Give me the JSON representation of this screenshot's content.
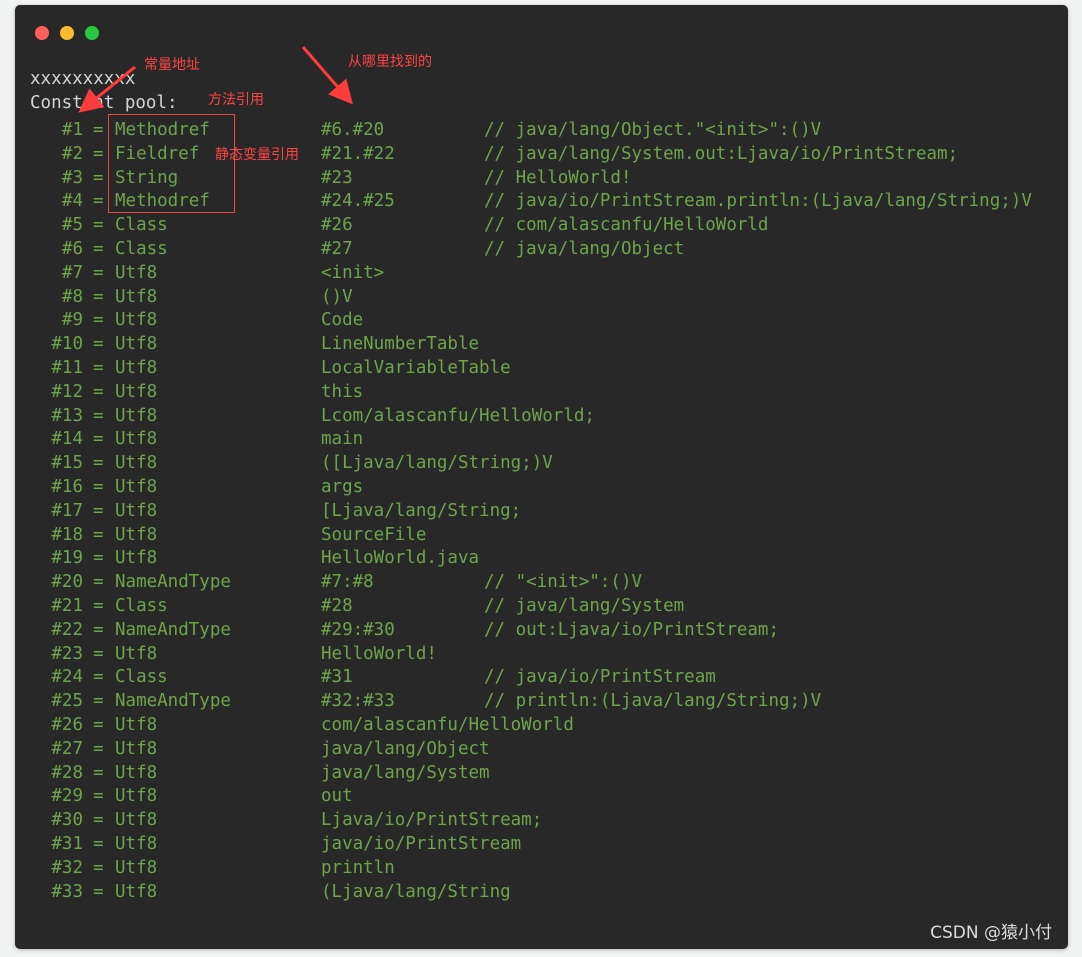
{
  "window": {
    "traffic_lights": {
      "close": "#fe5f57",
      "minimize": "#febc2e",
      "maximize": "#28c840"
    }
  },
  "terminal": {
    "line1": "xxxxxxxxxx",
    "line2": "Constant pool:",
    "rows": [
      {
        "idx": "#1",
        "eq": "=",
        "tag": "Methodref",
        "val": "#6.#20",
        "cmt": "// java/lang/Object.\"<init>\":()V"
      },
      {
        "idx": "#2",
        "eq": "=",
        "tag": "Fieldref",
        "val": "#21.#22",
        "cmt": "// java/lang/System.out:Ljava/io/PrintStream;"
      },
      {
        "idx": "#3",
        "eq": "=",
        "tag": "String",
        "val": "#23",
        "cmt": "// HelloWorld!"
      },
      {
        "idx": "#4",
        "eq": "=",
        "tag": "Methodref",
        "val": "#24.#25",
        "cmt": "// java/io/PrintStream.println:(Ljava/lang/String;)V"
      },
      {
        "idx": "#5",
        "eq": "=",
        "tag": "Class",
        "val": "#26",
        "cmt": "// com/alascanfu/HelloWorld"
      },
      {
        "idx": "#6",
        "eq": "=",
        "tag": "Class",
        "val": "#27",
        "cmt": "// java/lang/Object"
      },
      {
        "idx": "#7",
        "eq": "=",
        "tag": "Utf8",
        "val": "<init>",
        "cmt": ""
      },
      {
        "idx": "#8",
        "eq": "=",
        "tag": "Utf8",
        "val": "()V",
        "cmt": ""
      },
      {
        "idx": "#9",
        "eq": "=",
        "tag": "Utf8",
        "val": "Code",
        "cmt": ""
      },
      {
        "idx": "#10",
        "eq": "=",
        "tag": "Utf8",
        "val": "LineNumberTable",
        "cmt": ""
      },
      {
        "idx": "#11",
        "eq": "=",
        "tag": "Utf8",
        "val": "LocalVariableTable",
        "cmt": ""
      },
      {
        "idx": "#12",
        "eq": "=",
        "tag": "Utf8",
        "val": "this",
        "cmt": ""
      },
      {
        "idx": "#13",
        "eq": "=",
        "tag": "Utf8",
        "val": "Lcom/alascanfu/HelloWorld;",
        "cmt": ""
      },
      {
        "idx": "#14",
        "eq": "=",
        "tag": "Utf8",
        "val": "main",
        "cmt": ""
      },
      {
        "idx": "#15",
        "eq": "=",
        "tag": "Utf8",
        "val": "([Ljava/lang/String;)V",
        "cmt": ""
      },
      {
        "idx": "#16",
        "eq": "=",
        "tag": "Utf8",
        "val": "args",
        "cmt": ""
      },
      {
        "idx": "#17",
        "eq": "=",
        "tag": "Utf8",
        "val": "[Ljava/lang/String;",
        "cmt": ""
      },
      {
        "idx": "#18",
        "eq": "=",
        "tag": "Utf8",
        "val": "SourceFile",
        "cmt": ""
      },
      {
        "idx": "#19",
        "eq": "=",
        "tag": "Utf8",
        "val": "HelloWorld.java",
        "cmt": ""
      },
      {
        "idx": "#20",
        "eq": "=",
        "tag": "NameAndType",
        "val": "#7:#8",
        "cmt": "// \"<init>\":()V"
      },
      {
        "idx": "#21",
        "eq": "=",
        "tag": "Class",
        "val": "#28",
        "cmt": "// java/lang/System"
      },
      {
        "idx": "#22",
        "eq": "=",
        "tag": "NameAndType",
        "val": "#29:#30",
        "cmt": "// out:Ljava/io/PrintStream;"
      },
      {
        "idx": "#23",
        "eq": "=",
        "tag": "Utf8",
        "val": "HelloWorld!",
        "cmt": ""
      },
      {
        "idx": "#24",
        "eq": "=",
        "tag": "Class",
        "val": "#31",
        "cmt": "// java/io/PrintStream"
      },
      {
        "idx": "#25",
        "eq": "=",
        "tag": "NameAndType",
        "val": "#32:#33",
        "cmt": "// println:(Ljava/lang/String;)V"
      },
      {
        "idx": "#26",
        "eq": "=",
        "tag": "Utf8",
        "val": "com/alascanfu/HelloWorld",
        "cmt": ""
      },
      {
        "idx": "#27",
        "eq": "=",
        "tag": "Utf8",
        "val": "java/lang/Object",
        "cmt": ""
      },
      {
        "idx": "#28",
        "eq": "=",
        "tag": "Utf8",
        "val": "java/lang/System",
        "cmt": ""
      },
      {
        "idx": "#29",
        "eq": "=",
        "tag": "Utf8",
        "val": "out",
        "cmt": ""
      },
      {
        "idx": "#30",
        "eq": "=",
        "tag": "Utf8",
        "val": "Ljava/io/PrintStream;",
        "cmt": ""
      },
      {
        "idx": "#31",
        "eq": "=",
        "tag": "Utf8",
        "val": "java/io/PrintStream",
        "cmt": ""
      },
      {
        "idx": "#32",
        "eq": "=",
        "tag": "Utf8",
        "val": "println",
        "cmt": ""
      },
      {
        "idx": "#33",
        "eq": "=",
        "tag": "Utf8",
        "val": "(Ljava/lang/String",
        "cmt": ""
      }
    ]
  },
  "annotations": {
    "constant_address": "常量地址",
    "where_found": "从哪里找到的",
    "method_ref": "方法引用",
    "static_var_ref": "静态变量引用",
    "color": "#ff4444"
  },
  "watermark": "CSDN @猿小付"
}
